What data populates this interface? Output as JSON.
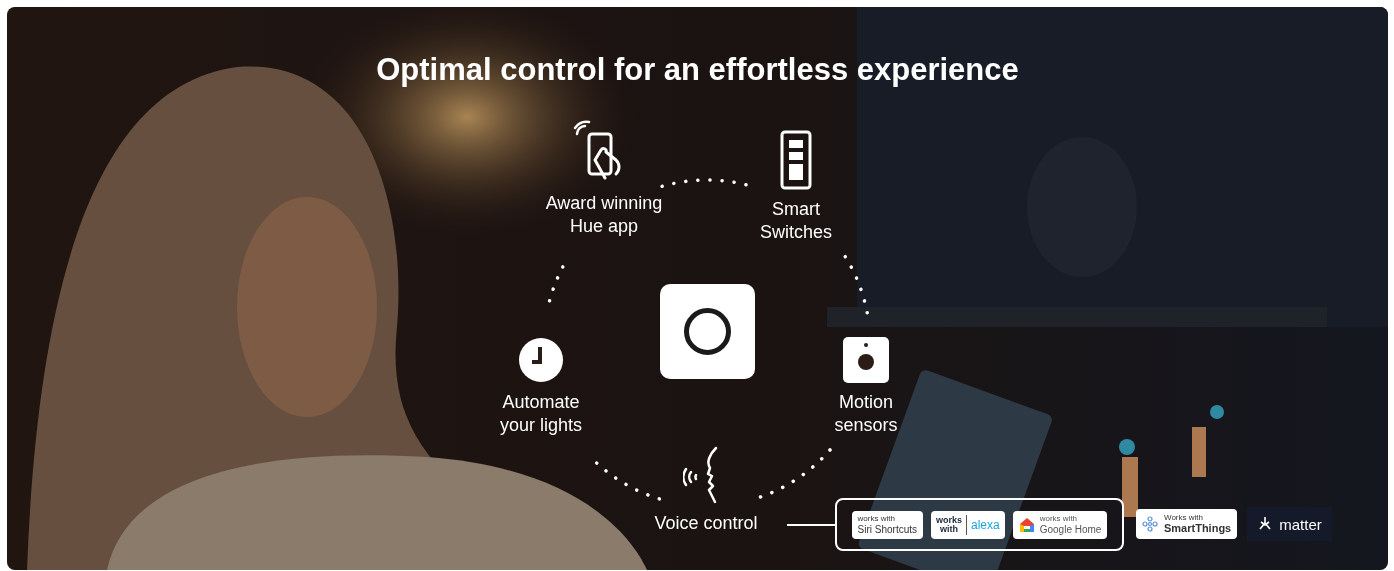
{
  "title": "Optimal control for an effortless experience",
  "hub": {
    "kind": "bridge"
  },
  "features": [
    {
      "kind": "app",
      "lines": [
        "Award winning",
        "Hue app"
      ]
    },
    {
      "kind": "switch",
      "lines": [
        "Smart",
        "Switches"
      ]
    },
    {
      "kind": "automate",
      "lines": [
        "Automate",
        "your lights"
      ]
    },
    {
      "kind": "motion",
      "lines": [
        "Motion",
        "sensors"
      ]
    },
    {
      "kind": "voice",
      "lines": [
        "Voice control"
      ]
    }
  ],
  "voice_partners": [
    {
      "kind": "siri",
      "small": "works with",
      "large": "Siri Shortcuts"
    },
    {
      "kind": "alexa",
      "small": "works with",
      "large": "alexa"
    },
    {
      "kind": "google",
      "small": "works with",
      "large": "Google Home"
    }
  ],
  "other_partners": [
    {
      "kind": "smartthings",
      "small": "Works with",
      "large": "SmartThings"
    },
    {
      "kind": "matter",
      "large": "matter"
    }
  ]
}
